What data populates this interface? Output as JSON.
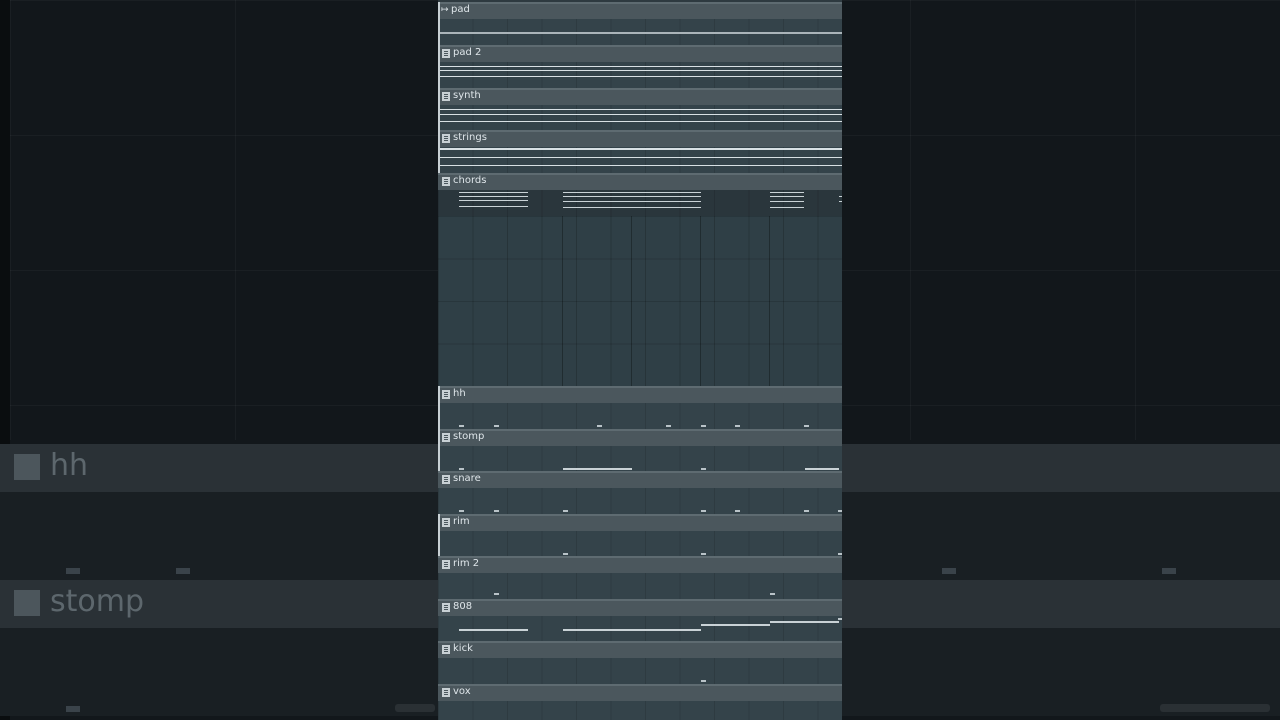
{
  "tracks": [
    {
      "name": "pad",
      "icon": "arrow-icon"
    },
    {
      "name": "pad 2",
      "icon": "pattern-icon"
    },
    {
      "name": "synth",
      "icon": "pattern-icon"
    },
    {
      "name": "strings",
      "icon": "pattern-icon"
    },
    {
      "name": "chords",
      "icon": "pattern-icon"
    },
    {
      "name": "hh",
      "icon": "pattern-icon"
    },
    {
      "name": "stomp",
      "icon": "pattern-icon"
    },
    {
      "name": "snare",
      "icon": "pattern-icon"
    },
    {
      "name": "rim",
      "icon": "pattern-icon"
    },
    {
      "name": "rim 2",
      "icon": "pattern-icon"
    },
    {
      "name": "808",
      "icon": "pattern-icon"
    },
    {
      "name": "kick",
      "icon": "pattern-icon"
    },
    {
      "name": "vox",
      "icon": "pattern-icon"
    }
  ],
  "background": {
    "track_a": "hh",
    "track_b": "stomp"
  },
  "colors": {
    "panel": "#2e3a40",
    "header": "#4b575d",
    "note": "#d8e0e4"
  }
}
